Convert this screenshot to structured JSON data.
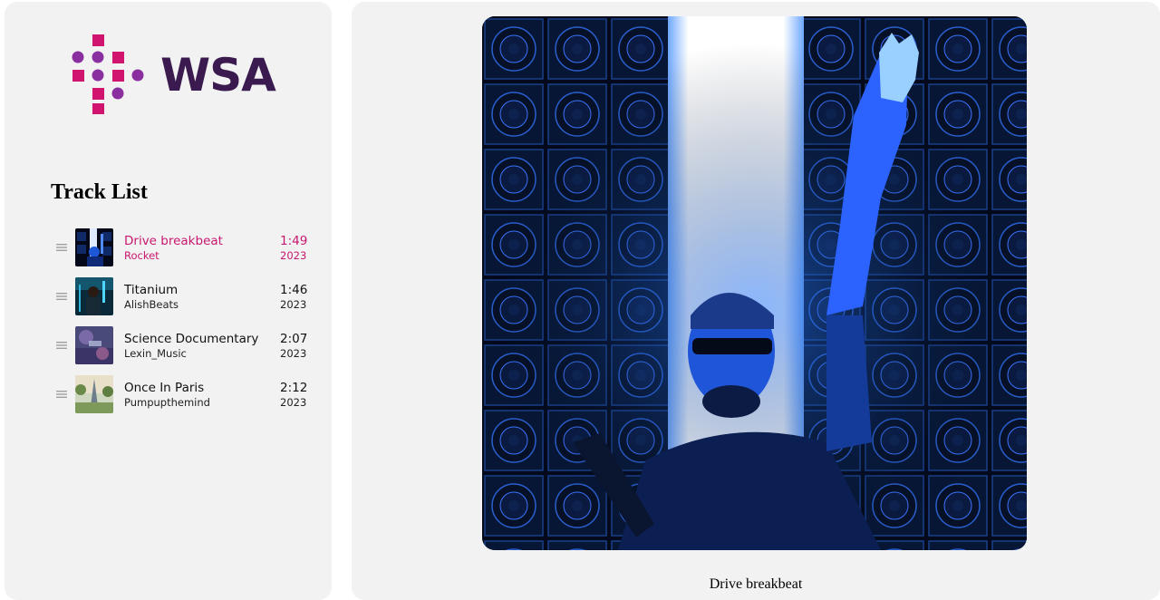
{
  "brand": {
    "name": "WSA",
    "dot_color_magenta": "#d1146e",
    "dot_color_purple": "#8a2fa0",
    "wordmark_color": "#3b1a4f"
  },
  "track_list": {
    "heading": "Track List",
    "tracks": [
      {
        "title": "Drive breakbeat",
        "artist": "Rocket",
        "duration": "1:49",
        "year": "2023",
        "active": true
      },
      {
        "title": "Titanium",
        "artist": "AlishBeats",
        "duration": "1:46",
        "year": "2023",
        "active": false
      },
      {
        "title": "Science Documentary",
        "artist": "Lexin_Music",
        "duration": "2:07",
        "year": "2023",
        "active": false
      },
      {
        "title": "Once In Paris",
        "artist": "Pumpupthemind",
        "duration": "2:12",
        "year": "2023",
        "active": false
      }
    ]
  },
  "player": {
    "now_playing_title": "Drive breakbeat"
  },
  "colors": {
    "accent": "#c8176f",
    "panel_bg": "#f2f2f2"
  },
  "icons": {
    "drag_handle": "drag-handle-icon"
  }
}
